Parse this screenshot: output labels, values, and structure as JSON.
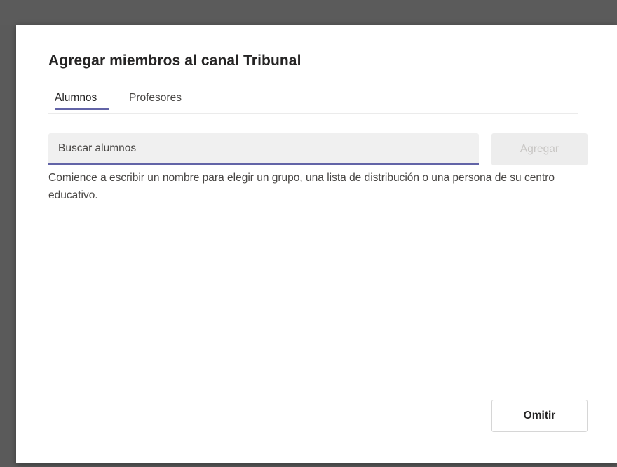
{
  "dialog": {
    "title": "Agregar miembros al canal Tribunal",
    "tabs": [
      {
        "label": "Alumnos",
        "selected": true
      },
      {
        "label": "Profesores",
        "selected": false
      }
    ],
    "search": {
      "placeholder": "Buscar alumnos",
      "value": ""
    },
    "add_button_label": "Agregar",
    "hint": "Comience a escribir un nombre para elegir un grupo, una lista de distribución o una persona de su centro educativo.",
    "skip_button_label": "Omitir"
  },
  "colors": {
    "accent": "#6264a7",
    "backdrop": "#5a5a5a",
    "text": "#252424",
    "disabled_text": "#c8c6c4"
  }
}
